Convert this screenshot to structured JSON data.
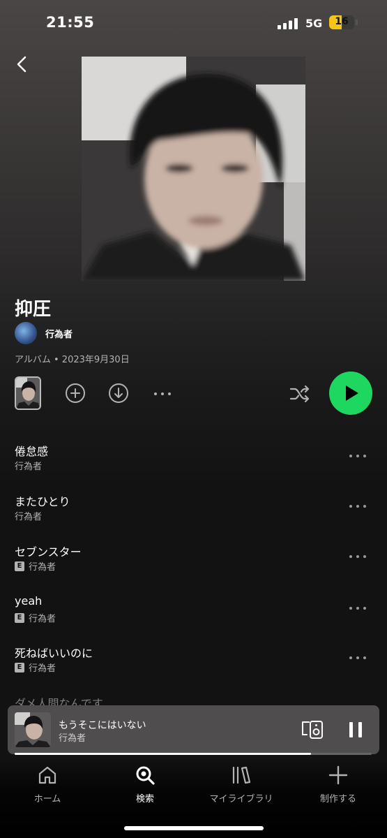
{
  "status_bar": {
    "time": "21:55",
    "network": "5G",
    "battery": "16",
    "battery_level": 0.16
  },
  "album": {
    "title": "抑圧",
    "artist": "行為者",
    "meta": "アルバム • 2023年9月30日"
  },
  "icons": {
    "back": "chevron-left-icon",
    "add": "add-circle-icon",
    "download": "download-circle-icon",
    "more": "more-horizontal-icon",
    "shuffle": "shuffle-icon",
    "play": "play-icon",
    "device": "connect-device-icon",
    "pause": "pause-icon"
  },
  "tracks": [
    {
      "title": "倦怠感",
      "artist": "行為者",
      "explicit": false
    },
    {
      "title": "またひとり",
      "artist": "行為者",
      "explicit": false
    },
    {
      "title": "セブンスター",
      "artist": "行為者",
      "explicit": true,
      "badge": "E"
    },
    {
      "title": "yeah",
      "artist": "行為者",
      "explicit": true,
      "badge": "E"
    },
    {
      "title": "死ねばいいのに",
      "artist": "行為者",
      "explicit": true,
      "badge": "E"
    },
    {
      "title": "ダメ人間なんです",
      "artist": "",
      "explicit": false
    }
  ],
  "now_playing": {
    "title": "もうそこにはいない",
    "artist": "行為者",
    "progress": 0.83
  },
  "nav": [
    {
      "label": "ホーム",
      "icon": "home-icon",
      "active": false
    },
    {
      "label": "検索",
      "icon": "search-icon",
      "active": true
    },
    {
      "label": "マイライブラリ",
      "icon": "library-icon",
      "active": false
    },
    {
      "label": "制作する",
      "icon": "plus-icon",
      "active": false
    }
  ],
  "colors": {
    "accent": "#1ed760",
    "background": "#121212",
    "muted_text": "#b3b3b3"
  }
}
